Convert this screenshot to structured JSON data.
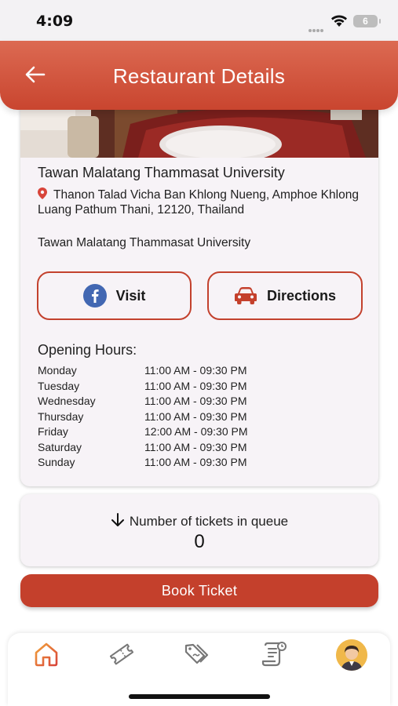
{
  "status_bar": {
    "time": "4:09",
    "battery": "6"
  },
  "header": {
    "title": "Restaurant Details",
    "back_icon": "arrow-left-icon"
  },
  "restaurant": {
    "name": "Tawan Malatang Thammasat University",
    "address": "Thanon Talad Vicha Ban Khlong Nueng, Amphoe Khlong Luang Pathum Thani, 12120, Thailand",
    "subname": "Tawan Malatang Thammasat University"
  },
  "actions": {
    "visit_label": "Visit",
    "directions_label": "Directions"
  },
  "opening_hours": {
    "title": "Opening Hours:",
    "rows": [
      {
        "day": "Monday",
        "time": "11:00 AM - 09:30 PM"
      },
      {
        "day": "Tuesday",
        "time": "11:00 AM - 09:30 PM"
      },
      {
        "day": "Wednesday",
        "time": "11:00 AM - 09:30 PM"
      },
      {
        "day": "Thursday",
        "time": "11:00 AM - 09:30 PM"
      },
      {
        "day": "Friday",
        "time": "12:00 AM - 09:30 PM"
      },
      {
        "day": "Saturday",
        "time": "11:00 AM - 09:30 PM"
      },
      {
        "day": "Sunday",
        "time": "11:00 AM - 09:30 PM"
      }
    ]
  },
  "queue": {
    "label": "Number of tickets in queue",
    "count": "0"
  },
  "book_button": {
    "label": "Book Ticket"
  },
  "colors": {
    "brand": "#c4402c",
    "header_top": "#dc6a52",
    "card_bg": "#f7f3f7"
  }
}
